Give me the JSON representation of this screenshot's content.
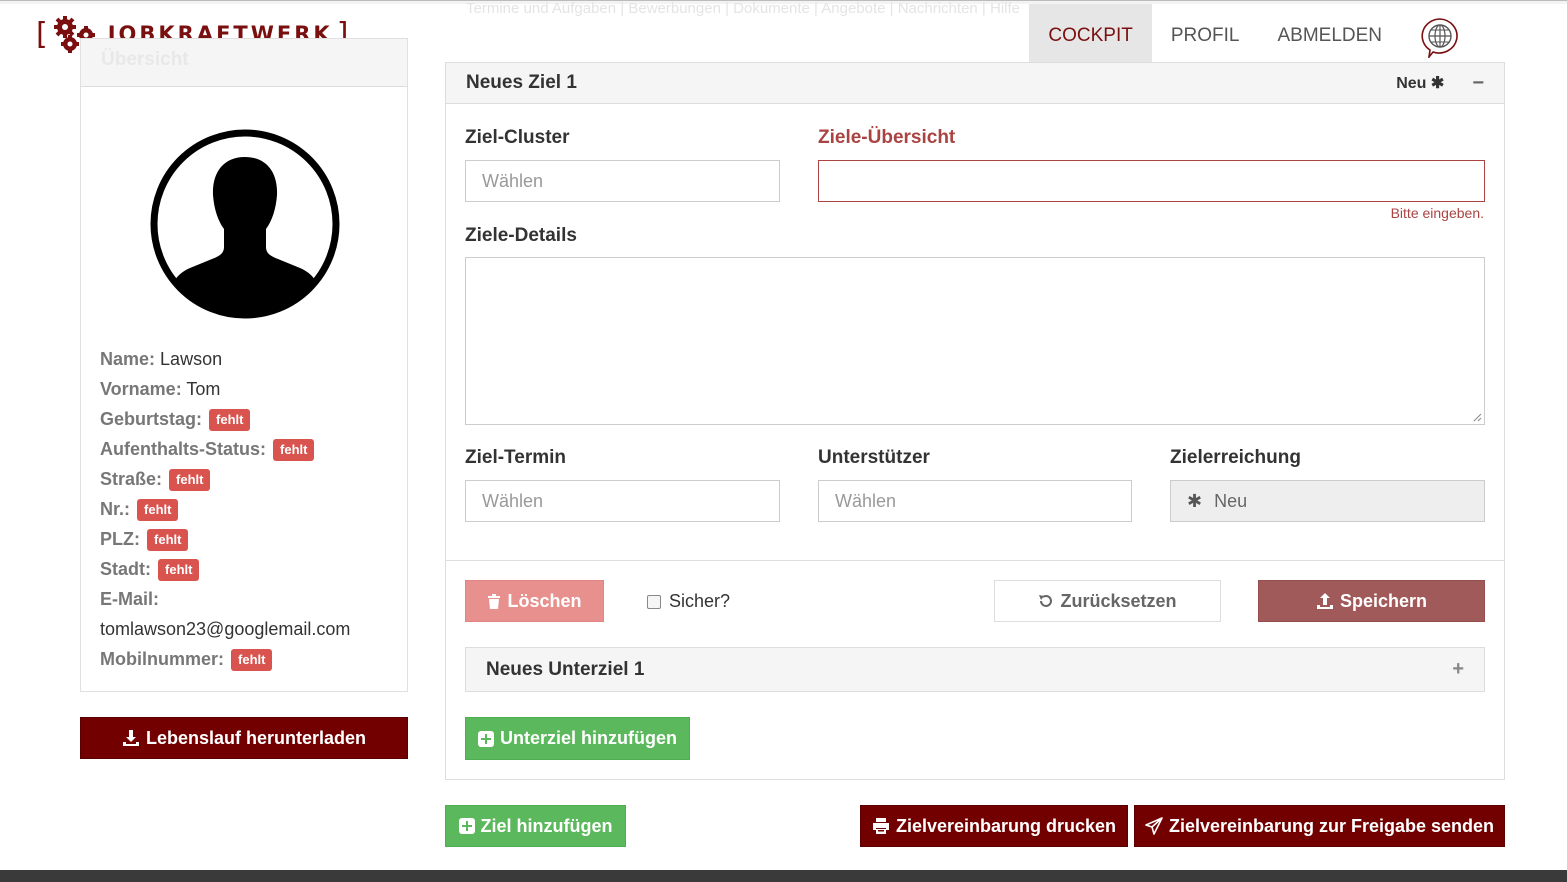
{
  "brand": {
    "name": "JobKraftwerk",
    "display": "JOBKRAFTWERK"
  },
  "nav": {
    "ghost_items": "Termine und Aufgaben  |  Bewerbungen  |  Dokumente  |  Angebote  |  Nachrichten  |  Hilfe",
    "items": [
      {
        "label": "COCKPIT",
        "active": true
      },
      {
        "label": "PROFIL",
        "active": false
      },
      {
        "label": "ABMELDEN",
        "active": false
      }
    ],
    "language_icon": "globe-speech-icon"
  },
  "profile": {
    "panel_title": "Übersicht",
    "name_label": "Name:",
    "name_value": "Lawson",
    "firstname_label": "Vorname:",
    "firstname_value": "Tom",
    "birthday_label": "Geburtstag:",
    "residence_label": "Aufenthalts-Status:",
    "street_label": "Straße:",
    "number_label": "Nr.:",
    "zip_label": "PLZ:",
    "city_label": "Stadt:",
    "email_label": "E-Mail:",
    "email_value": "tomlawson23@googlemail.com",
    "mobile_label": "Mobilnummer:",
    "missing_badge": "fehlt",
    "download_cv": "Lebenslauf herunterladen"
  },
  "goal": {
    "title": "Neues Ziel 1",
    "status": "Neu",
    "cluster_label": "Ziel-Cluster",
    "cluster_placeholder": "Wählen",
    "overview_label": "Ziele-Übersicht",
    "overview_value": "",
    "overview_error": "Bitte eingeben.",
    "details_label": "Ziele-Details",
    "date_label": "Ziel-Termin",
    "date_placeholder": "Wählen",
    "supporter_label": "Unterstützer",
    "supporter_placeholder": "Wählen",
    "achievement_label": "Zielerreichung",
    "achievement_value": "Neu",
    "delete_btn": "Löschen",
    "confirm_label": "Sicher?",
    "reset_btn": "Zurücksetzen",
    "save_btn": "Speichern",
    "subgoal_title": "Neues Unterziel 1",
    "add_subgoal_btn": "Unterziel hinzufügen"
  },
  "footer_actions": {
    "add_goal": "Ziel hinzufügen",
    "print": "Zielvereinbarung drucken",
    "send": "Zielvereinbarung zur Freigabe senden"
  },
  "colors": {
    "brand": "#730000",
    "error": "#a94442",
    "success": "#5cb85c",
    "danger": "#d9534f"
  }
}
